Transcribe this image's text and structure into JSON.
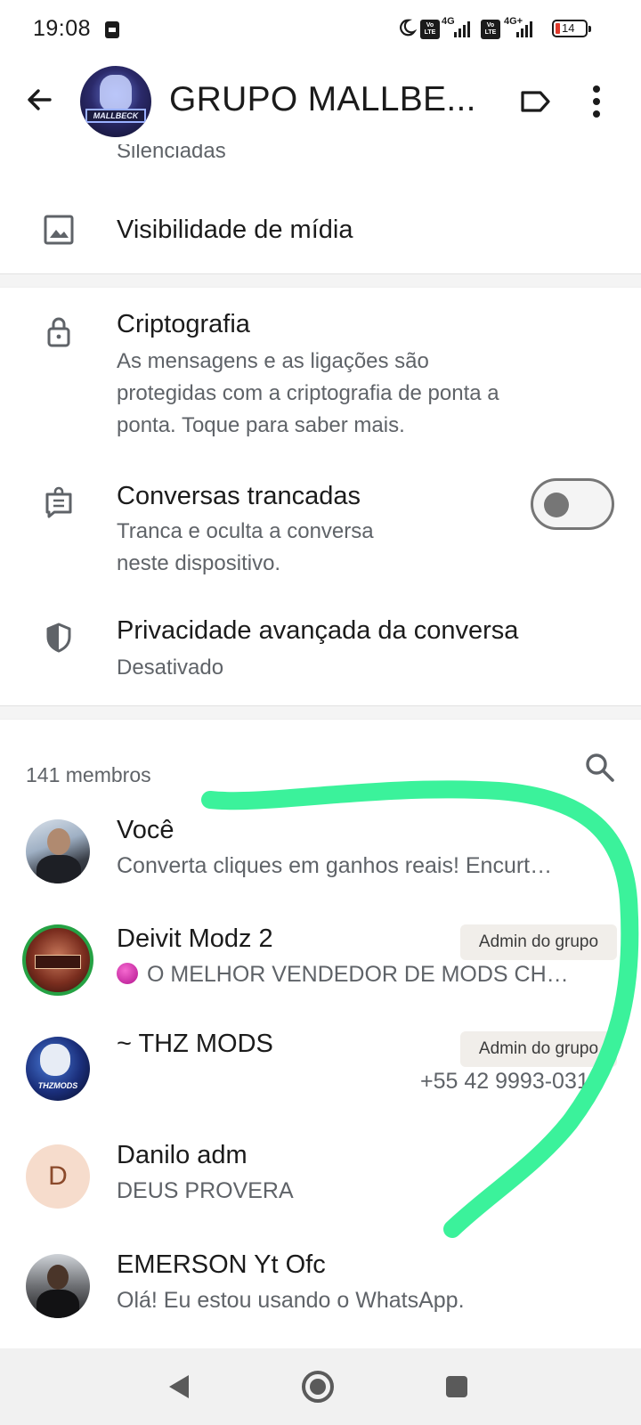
{
  "status_bar": {
    "time": "19:08",
    "network_1": "4G",
    "network_2": "4G+",
    "volte": "Vo LTE",
    "battery": "14",
    "battery_color": "#e0392b"
  },
  "app_bar": {
    "group_name": "GRUPO MALLBE...",
    "avatar_text": "MALLBECK",
    "icons": [
      "back-arrow-icon",
      "label-icon",
      "more-vert-icon"
    ]
  },
  "settings": {
    "cutoff_text": "Silenciadas",
    "media_visibility": {
      "title": "Visibilidade de mídia",
      "icon": "image-icon"
    },
    "encryption": {
      "title": "Criptografia",
      "line1": "As mensagens e as ligações são",
      "line2": "protegidas com a criptografia de ponta a",
      "line3": "ponta. Toque para saber mais.",
      "icon": "lock-icon"
    },
    "locked_chats": {
      "title": "Conversas trancadas",
      "line1": "Tranca e oculta a conversa",
      "line2": "neste dispositivo.",
      "icon": "locked-chat-icon",
      "toggle_on": false
    },
    "advanced_privacy": {
      "title": "Privacidade avançada da conversa",
      "sub": "Desativado",
      "icon": "shield-icon"
    }
  },
  "members": {
    "header": "141 membros",
    "list": [
      {
        "name": "Você",
        "status": "Converta cliques em ganhos reais! Encurt…"
      },
      {
        "name": "Deivit Modz 2",
        "status": "O MELHOR VENDEDOR DE MODS CH…",
        "badge": "Admin do grupo"
      },
      {
        "name": "~ THZ MODS",
        "phone": "+55 42 9993-0317",
        "badge": "Admin do grupo",
        "avatar_text": "THZMODS"
      },
      {
        "name": "Danilo adm",
        "status": "DEUS PROVERA",
        "initial": "D"
      },
      {
        "name": "EMERSON Yt Ofc",
        "status": "Olá! Eu estou usando o WhatsApp."
      }
    ]
  },
  "colors": {
    "annotation_green": "#3bf29b",
    "text_primary": "#1b1b1b",
    "text_secondary": "#5f6368",
    "admin_badge_bg": "#f1eeea",
    "danilo_avatar_bg": "#f6dccc",
    "danilo_avatar_fg": "#8b4a2b"
  },
  "nav_bar": [
    "back-triangle-icon",
    "home-circle-icon",
    "recents-square-icon"
  ]
}
